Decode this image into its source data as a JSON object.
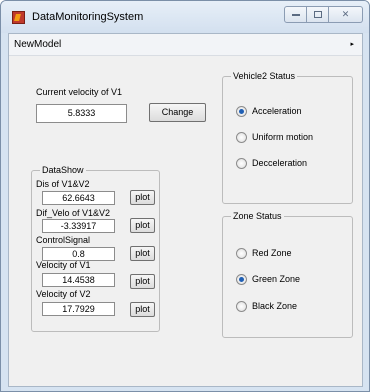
{
  "window": {
    "title": "DataMonitoringSystem"
  },
  "menu": {
    "item": "NewModel"
  },
  "velocity": {
    "label": "Current velocity of V1",
    "value": "5.8333",
    "change_label": "Change"
  },
  "datashow": {
    "title": "DataShow",
    "plot_label": "plot",
    "rows": [
      {
        "label": "Dis of V1&V2",
        "value": "62.6643"
      },
      {
        "label": "Dif_Velo of V1&V2",
        "value": "-3.33917"
      },
      {
        "label": "ControlSignal",
        "value": "0.8"
      },
      {
        "label": "Velocity of V1",
        "value": "14.4538"
      },
      {
        "label": "Velocity of V2",
        "value": "17.7929"
      }
    ]
  },
  "vehicle2_status": {
    "title": "Vehicle2 Status",
    "options": [
      {
        "label": "Acceleration",
        "checked": true
      },
      {
        "label": "Uniform motion",
        "checked": false
      },
      {
        "label": "Decceleration",
        "checked": false
      }
    ]
  },
  "zone_status": {
    "title": "Zone Status",
    "options": [
      {
        "label": "Red Zone",
        "checked": false
      },
      {
        "label": "Green Zone",
        "checked": true
      },
      {
        "label": "Black Zone",
        "checked": false
      }
    ]
  }
}
